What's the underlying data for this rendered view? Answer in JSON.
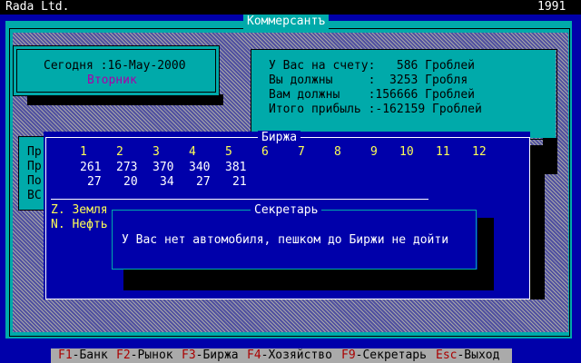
{
  "topbar": {
    "company": "Rada Ltd.",
    "year": "1991"
  },
  "main": {
    "title": "Коммерсантъ"
  },
  "date_panel": {
    "date_line": "Сегодня :16-May-2000",
    "weekday": "Вторник"
  },
  "account": {
    "lines": [
      "У Вас на счету:   586 Гроблей",
      "Вы должны     :  3253 Гробля",
      "Вам должны    :156666 Гроблей",
      "Итого прибыль :-162159 Гроблей"
    ]
  },
  "left_labels": [
    "Пр",
    "Пр",
    "По",
    "ВС"
  ],
  "exchange": {
    "title": "Биржа",
    "headers": [
      "1",
      "2",
      "3",
      "4",
      "5",
      "6",
      "7",
      "8",
      "9",
      "10",
      "11",
      "12"
    ],
    "row1": [
      "261",
      "273",
      "370",
      "340",
      "381"
    ],
    "row2": [
      "27",
      "20",
      "34",
      "27",
      "21"
    ],
    "items": [
      "Z. Земля",
      "N. Нефть"
    ]
  },
  "secretary": {
    "title": "Секретарь",
    "message": "У Вас нет автомобиля, пешком до Биржи не дойти"
  },
  "fkeys": [
    {
      "key": "F1",
      "label": "-Банк "
    },
    {
      "key": "F2",
      "label": "-Рынок "
    },
    {
      "key": "F3",
      "label": "-Биржа "
    },
    {
      "key": "F4",
      "label": "-Хозяйство "
    },
    {
      "key": "F9",
      "label": "-Секретарь "
    },
    {
      "key": "Esc",
      "label": "-Выход"
    }
  ]
}
